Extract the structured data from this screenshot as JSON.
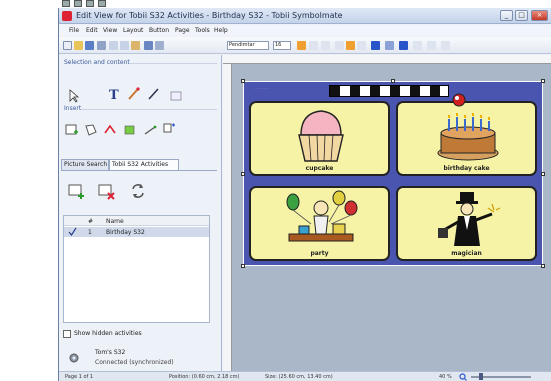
{
  "window": {
    "title": "Edit View for Tobii S32 Activities - Birthday S32 - Tobii Symbolmate"
  },
  "menu": [
    "File",
    "Edit",
    "View",
    "Layout",
    "Button",
    "Page",
    "Tools",
    "Help"
  ],
  "toolbar": {
    "font": "Pendimtar",
    "size": "16"
  },
  "left_panel": {
    "selection_title": "Selection and content",
    "insert_title": "Insert",
    "tabs": [
      "Picture Search",
      "Tobii S32 Activities"
    ],
    "list_header": {
      "num": "#",
      "name": "Name"
    },
    "list_rows": [
      {
        "num": "1",
        "name": "Birthday S32"
      }
    ],
    "show_hidden": "Show hidden activities",
    "device_name": "Tom's S32",
    "device_status": "Connected (synchronized)"
  },
  "cells": [
    {
      "label": "cupcake"
    },
    {
      "label": "birthday cake"
    },
    {
      "label": "party"
    },
    {
      "label": "magician"
    }
  ],
  "status": {
    "page": "Page 1 of 1",
    "position": "Position: (0.60 cm, 2.18 cm)",
    "size": "Size: (25.60 cm, 13.40 cm)",
    "zoom": "40 %"
  },
  "colors": {
    "page_bg": "#4a55b0",
    "cell_bg": "#f6f3a6",
    "accent_blue": "#3a5a9a"
  }
}
